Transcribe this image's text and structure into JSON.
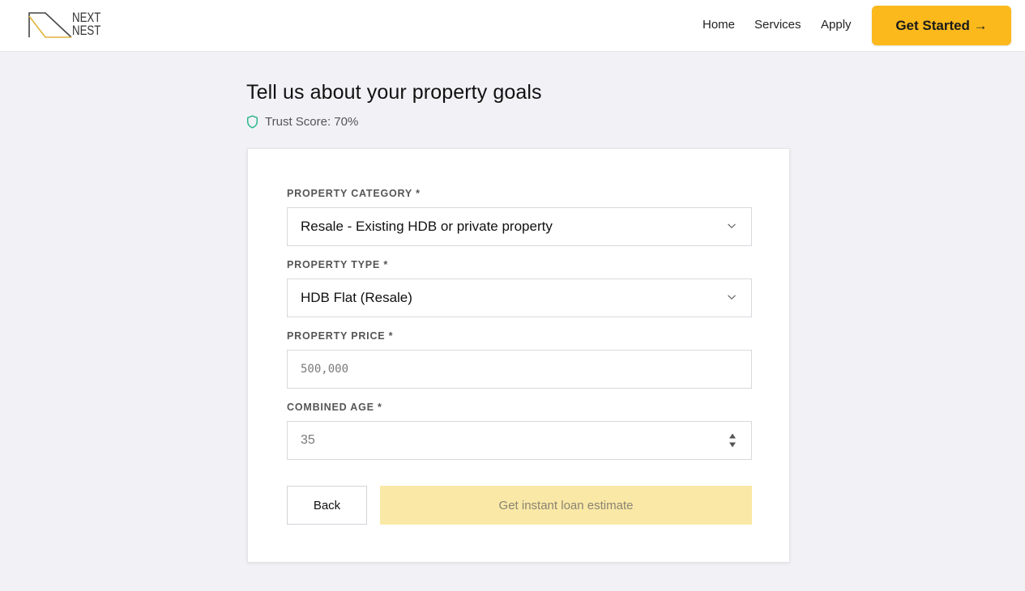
{
  "header": {
    "logo_text_line1": "NEXT",
    "logo_text_line2": "NEST",
    "nav": [
      {
        "label": "Home"
      },
      {
        "label": "Services"
      },
      {
        "label": "Apply"
      }
    ],
    "cta_label": "Get Started →"
  },
  "page": {
    "title": "Tell us about your property goals",
    "trust_score": "Trust Score: 70%"
  },
  "form": {
    "property_category": {
      "label": "PROPERTY CATEGORY *",
      "value": "Resale - Existing HDB or private property"
    },
    "property_type": {
      "label": "PROPERTY TYPE *",
      "value": "HDB Flat (Resale)"
    },
    "property_price": {
      "label": "PROPERTY PRICE *",
      "placeholder": "500,000"
    },
    "combined_age": {
      "label": "COMBINED AGE *",
      "placeholder": "35"
    },
    "back_label": "Back",
    "submit_label": "Get instant loan estimate"
  },
  "colors": {
    "accent": "#fbb91c",
    "accent_disabled": "#fae8a6",
    "trust_icon": "#2bb58a",
    "background": "#f2f2f6"
  },
  "icons": {
    "trust": "shield-icon",
    "select": "chevron-down-icon",
    "number": "spinner-icon"
  }
}
